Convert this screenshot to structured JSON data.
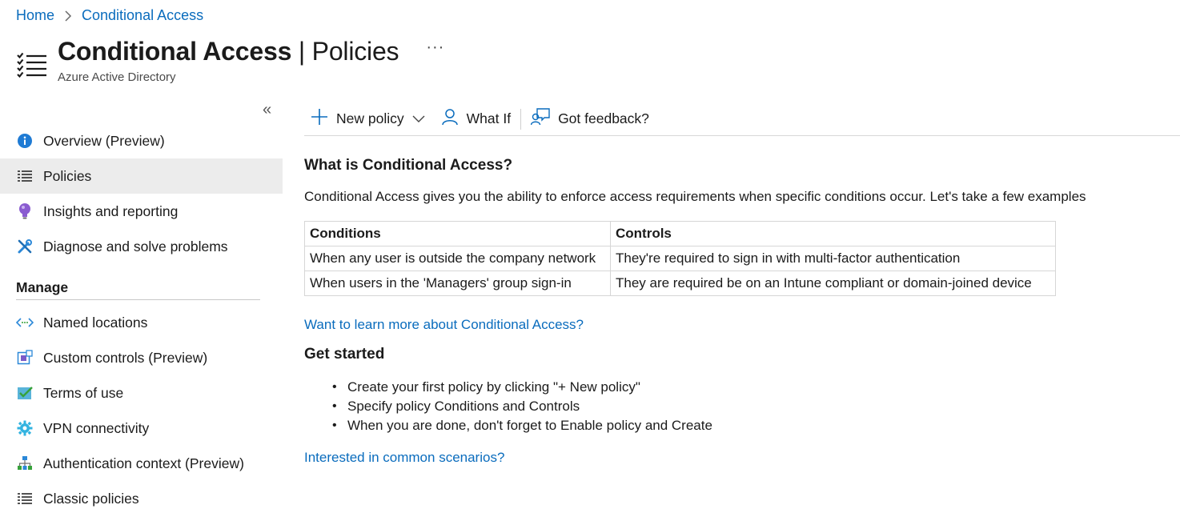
{
  "breadcrumb": {
    "home": "Home",
    "current": "Conditional Access"
  },
  "header": {
    "title_strong": "Conditional Access",
    "title_sep": " | ",
    "title_rest": "Policies",
    "subtitle": "Azure Active Directory",
    "more": "···"
  },
  "sidebar": {
    "collapse": "«",
    "items": [
      {
        "label": "Overview (Preview)",
        "icon": "info-icon"
      },
      {
        "label": "Policies",
        "icon": "list-icon",
        "active": true
      },
      {
        "label": "Insights and reporting",
        "icon": "lightbulb-icon"
      },
      {
        "label": "Diagnose and solve problems",
        "icon": "wrench-icon"
      }
    ],
    "manage_heading": "Manage",
    "manage_items": [
      {
        "label": "Named locations",
        "icon": "code-arrows-icon"
      },
      {
        "label": "Custom controls (Preview)",
        "icon": "custom-controls-icon"
      },
      {
        "label": "Terms of use",
        "icon": "checkbox-icon"
      },
      {
        "label": "VPN connectivity",
        "icon": "gear-icon"
      },
      {
        "label": "Authentication context (Preview)",
        "icon": "hierarchy-icon"
      },
      {
        "label": "Classic policies",
        "icon": "list-icon"
      }
    ]
  },
  "toolbar": {
    "new_policy": "New policy",
    "what_if": "What If",
    "feedback": "Got feedback?"
  },
  "main": {
    "heading": "What is Conditional Access?",
    "intro": "Conditional Access gives you the ability to enforce access requirements when specific conditions occur. Let's take a few examples",
    "table": {
      "headers": [
        "Conditions",
        "Controls"
      ],
      "rows": [
        [
          "When any user is outside the company network",
          "They're required to sign in with multi-factor authentication"
        ],
        [
          "When users in the 'Managers' group sign-in",
          "They are required be on an Intune compliant or domain-joined device"
        ]
      ]
    },
    "learn_more": "Want to learn more about Conditional Access?",
    "get_started": "Get started",
    "steps": [
      "Create your first policy by clicking \"+ New policy\"",
      "Specify policy Conditions and Controls",
      "When you are done, don't forget to Enable policy and Create"
    ],
    "scenarios": "Interested in common scenarios?"
  },
  "colors": {
    "link": "#0a6cbd",
    "active_bg": "#ececec"
  }
}
